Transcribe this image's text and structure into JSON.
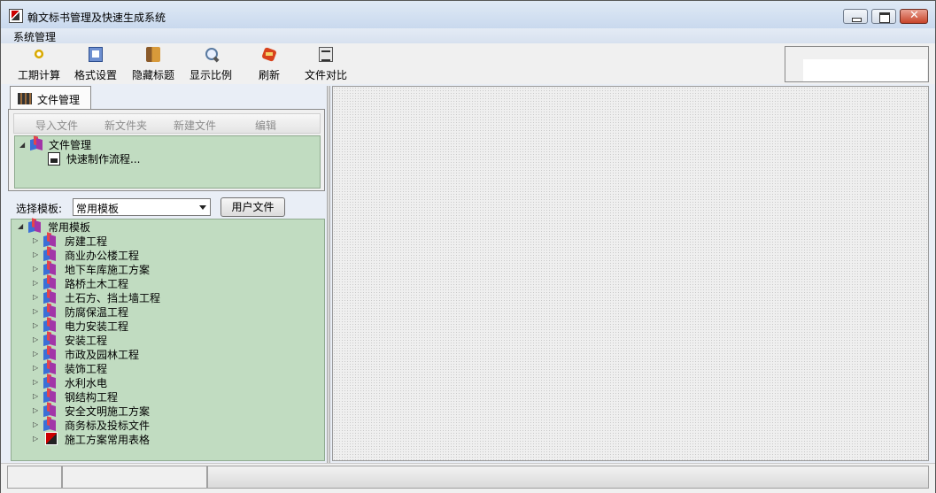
{
  "window": {
    "title": "翰文标书管理及快速生成系统"
  },
  "menu": {
    "items": [
      "系统管理"
    ]
  },
  "toolbar": {
    "buttons": [
      {
        "label": "工期计算",
        "icon": "gear-icon"
      },
      {
        "label": "格式设置",
        "icon": "format-icon"
      },
      {
        "label": "隐藏标题",
        "icon": "book-icon"
      },
      {
        "label": "显示比例",
        "icon": "zoom-icon"
      },
      {
        "label": "刷新",
        "icon": "refresh-icon"
      },
      {
        "label": "文件对比",
        "icon": "compare-icon"
      }
    ]
  },
  "left_panel": {
    "tab_label": "文件管理",
    "file_toolbar": [
      "导入文件",
      "新文件夹",
      "新建文件",
      "编辑"
    ],
    "file_tree": {
      "root": "文件管理",
      "children": [
        "快速制作流程..."
      ]
    },
    "template_label": "选择模板:",
    "template_selected": "常用模板",
    "user_files_button": "用户文件",
    "template_tree": {
      "root": "常用模板",
      "children": [
        "房建工程",
        "商业办公楼工程",
        "地下车库施工方案",
        "路桥土木工程",
        "土石方、挡土墙工程",
        "防腐保温工程",
        "电力安装工程",
        "安装工程",
        "市政及园林工程",
        "装饰工程",
        "水利水电",
        "钢结构工程",
        "安全文明施工方案",
        "商务标及投标文件",
        "施工方案常用表格"
      ]
    }
  }
}
